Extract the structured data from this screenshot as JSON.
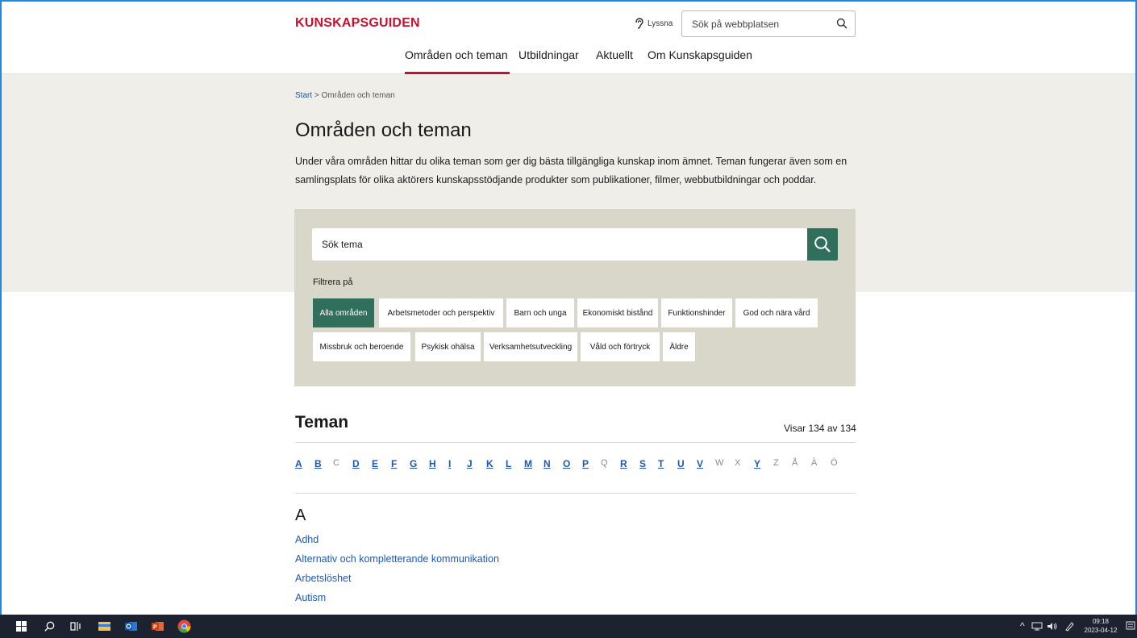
{
  "header": {
    "logo": "KUNSKAPSGUIDEN",
    "listen_label": "Lyssna",
    "search_placeholder": "Sök på webbplatsen"
  },
  "nav": {
    "items": [
      {
        "label": "Områden och teman",
        "active": true
      },
      {
        "label": "Utbildningar",
        "active": false
      },
      {
        "label": "Aktuellt",
        "active": false
      },
      {
        "label": "Om Kunskapsguiden",
        "active": false
      }
    ]
  },
  "breadcrumb": {
    "start": "Start",
    "separator": ">",
    "current": "Områden och teman"
  },
  "page": {
    "title": "Områden och teman",
    "intro": "Under våra områden hittar du olika teman som ger dig bästa tillgängliga kunskap inom ämnet. Teman fungerar även som en samlingsplats för olika aktörers kunskapsstödjande produkter som publikationer, filmer, webbutbildningar och poddar."
  },
  "filter": {
    "search_placeholder": "Sök tema",
    "label": "Filtrera på",
    "chips": [
      {
        "label": "Alla områden",
        "active": true
      },
      {
        "label": "Arbetsmetoder och perspektiv",
        "active": false
      },
      {
        "label": "Barn och unga",
        "active": false
      },
      {
        "label": "Ekonomiskt bistånd",
        "active": false
      },
      {
        "label": "Funktionshinder",
        "active": false
      },
      {
        "label": "God och nära vård",
        "active": false
      },
      {
        "label": "Missbruk och beroende",
        "active": false
      },
      {
        "label": "Psykisk ohälsa",
        "active": false
      },
      {
        "label": "Verksamhetsutveckling",
        "active": false
      },
      {
        "label": "Våld och förtryck",
        "active": false
      },
      {
        "label": "Äldre",
        "active": false
      }
    ]
  },
  "themes": {
    "title": "Teman",
    "count": "Visar 134 av 134",
    "alphabet": [
      {
        "letter": "A",
        "link": true
      },
      {
        "letter": "B",
        "link": true
      },
      {
        "letter": "C",
        "link": false
      },
      {
        "letter": "D",
        "link": true
      },
      {
        "letter": "E",
        "link": true
      },
      {
        "letter": "F",
        "link": true
      },
      {
        "letter": "G",
        "link": true
      },
      {
        "letter": "H",
        "link": true
      },
      {
        "letter": "I",
        "link": true
      },
      {
        "letter": "J",
        "link": true
      },
      {
        "letter": "K",
        "link": true
      },
      {
        "letter": "L",
        "link": true
      },
      {
        "letter": "M",
        "link": true
      },
      {
        "letter": "N",
        "link": true
      },
      {
        "letter": "O",
        "link": true
      },
      {
        "letter": "P",
        "link": true
      },
      {
        "letter": "Q",
        "link": false
      },
      {
        "letter": "R",
        "link": true
      },
      {
        "letter": "S",
        "link": true
      },
      {
        "letter": "T",
        "link": true
      },
      {
        "letter": "U",
        "link": true
      },
      {
        "letter": "V",
        "link": true
      },
      {
        "letter": "W",
        "link": false
      },
      {
        "letter": "X",
        "link": false
      },
      {
        "letter": "Y",
        "link": true
      },
      {
        "letter": "Z",
        "link": false
      },
      {
        "letter": "Å",
        "link": false
      },
      {
        "letter": "Ä",
        "link": false
      },
      {
        "letter": "Ö",
        "link": false
      }
    ],
    "section_letter": "A",
    "items": [
      "Adhd",
      "Alternativ och kompletterande kommunikation",
      "Arbetslöshet",
      "Autism"
    ]
  },
  "taskbar": {
    "time": "09:18",
    "date": "2023-04-12",
    "icons": [
      "windows-start-icon",
      "search-icon",
      "task-view-icon",
      "file-explorer-icon",
      "outlook-icon",
      "powerpoint-icon",
      "chrome-icon"
    ]
  },
  "colors": {
    "brand_red": "#c8102e",
    "accent_green": "#2f6f5c",
    "link_blue": "#1f56b6",
    "band_beige": "#efeee9",
    "panel_beige": "#d8d7c9"
  }
}
